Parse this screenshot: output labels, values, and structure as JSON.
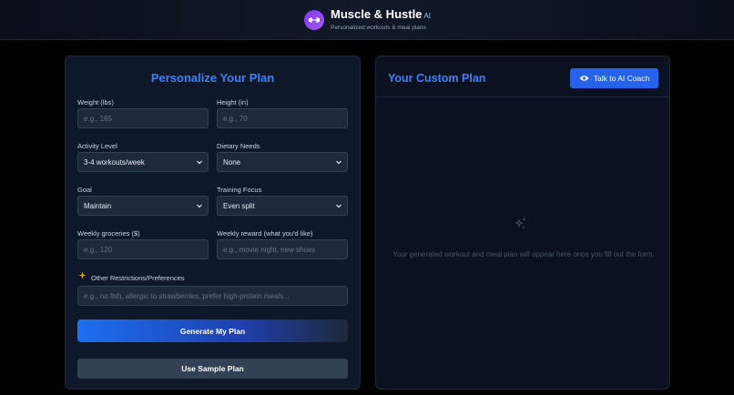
{
  "header": {
    "title": "Muscle & Hustle",
    "badge": "AI",
    "subtitle": "Personalized workouts & meal plans"
  },
  "form": {
    "title": "Personalize Your Plan",
    "weight": {
      "label": "Weight (lbs)",
      "placeholder": "e.g., 165",
      "value": ""
    },
    "height": {
      "label": "Height (in)",
      "placeholder": "e.g., 70",
      "value": ""
    },
    "activity": {
      "label": "Activity Level",
      "selected": "3-4 workouts/week"
    },
    "dietary": {
      "label": "Dietary Needs",
      "selected": "None"
    },
    "goal": {
      "label": "Goal",
      "selected": "Maintain"
    },
    "training": {
      "label": "Training Focus",
      "selected": "Even split"
    },
    "groceries": {
      "label": "Weekly groceries ($)",
      "placeholder": "e.g., 120",
      "value": ""
    },
    "reward": {
      "label": "Weekly reward (what you'd like)",
      "placeholder": "e.g., movie night, new shoes",
      "value": ""
    },
    "restrictions": {
      "label": "Other Restrictions/Preferences",
      "placeholder": "e.g., no fish, allergic to strawberries, prefer high-protein meals...",
      "value": ""
    },
    "generate_label": "Generate My Plan",
    "sample_label": "Use Sample Plan"
  },
  "plan": {
    "title": "Your Custom Plan",
    "coach_label": "Talk to AI Coach",
    "empty_message": "Your generated workout and meal plan will appear here once you fill out the form."
  },
  "colors": {
    "accent": "#3b82f6",
    "primary_button": "#2563eb",
    "logo": "#8b5cf6",
    "panel_bg": "#0f172a"
  },
  "icons": {
    "logo": "dumbbell-icon",
    "restrictions": "sparkle-icon",
    "coach": "eye-icon",
    "empty_state": "sparkle-icon",
    "dropdown": "chevron-down-icon"
  }
}
